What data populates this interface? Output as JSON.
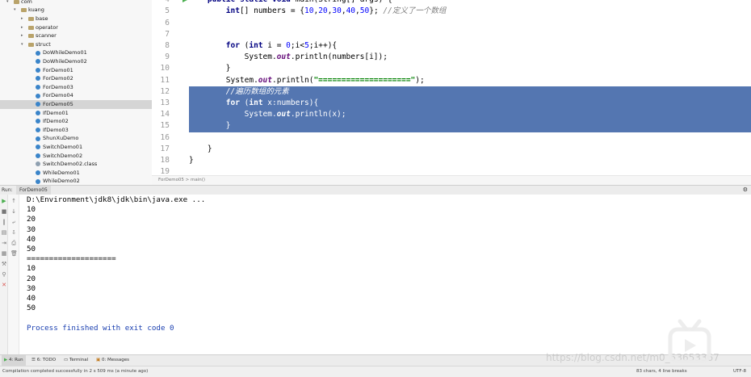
{
  "project_tree": {
    "items": [
      {
        "label": "com",
        "type": "folder",
        "indent": 1,
        "arrow": "v"
      },
      {
        "label": "kuang",
        "type": "folder",
        "indent": 2,
        "arrow": "v"
      },
      {
        "label": "base",
        "type": "folder",
        "indent": 3,
        "arrow": ">"
      },
      {
        "label": "operator",
        "type": "folder",
        "indent": 3,
        "arrow": ">"
      },
      {
        "label": "scanner",
        "type": "folder",
        "indent": 3,
        "arrow": ">"
      },
      {
        "label": "struct",
        "type": "folder",
        "indent": 3,
        "arrow": "v"
      },
      {
        "label": "DoWhileDemo01",
        "type": "class",
        "indent": 4
      },
      {
        "label": "DoWhileDemo02",
        "type": "class",
        "indent": 4
      },
      {
        "label": "ForDemo01",
        "type": "class",
        "indent": 4
      },
      {
        "label": "ForDemo02",
        "type": "class",
        "indent": 4
      },
      {
        "label": "ForDemo03",
        "type": "class",
        "indent": 4
      },
      {
        "label": "ForDemo04",
        "type": "class",
        "indent": 4
      },
      {
        "label": "ForDemo05",
        "type": "class",
        "indent": 4,
        "selected": true
      },
      {
        "label": "IfDemo01",
        "type": "class",
        "indent": 4
      },
      {
        "label": "IfDemo02",
        "type": "class",
        "indent": 4
      },
      {
        "label": "IfDemo03",
        "type": "class",
        "indent": 4
      },
      {
        "label": "ShunXuDemo",
        "type": "class",
        "indent": 4
      },
      {
        "label": "SwitchDemo01",
        "type": "class",
        "indent": 4
      },
      {
        "label": "SwitchDemo02",
        "type": "class",
        "indent": 4
      },
      {
        "label": "SwitchDemo02.class",
        "type": "file",
        "indent": 4
      },
      {
        "label": "WhileDemo01",
        "type": "class",
        "indent": 4
      },
      {
        "label": "WhileDemo02",
        "type": "class",
        "indent": 4
      }
    ]
  },
  "editor": {
    "lines": [
      {
        "n": "4",
        "text": "    public static void main(String[] args) {"
      },
      {
        "n": "5",
        "text": "        int[] numbers = {10,20,30,40,50}; //定义了一个数组"
      },
      {
        "n": "6",
        "text": ""
      },
      {
        "n": "7",
        "text": ""
      },
      {
        "n": "8",
        "text": "        for (int i = 0;i<5;i++){"
      },
      {
        "n": "9",
        "text": "            System.out.println(numbers[i]);"
      },
      {
        "n": "10",
        "text": "        }"
      },
      {
        "n": "11",
        "text": "        System.out.println(\"====================\");"
      },
      {
        "n": "12",
        "text": "        //遍历数组的元素"
      },
      {
        "n": "13",
        "text": "        for (int x:numbers){"
      },
      {
        "n": "14",
        "text": "            System.out.println(x);"
      },
      {
        "n": "15",
        "text": "        }"
      },
      {
        "n": "16",
        "text": ""
      },
      {
        "n": "17",
        "text": "    }"
      },
      {
        "n": "18",
        "text": "}"
      },
      {
        "n": "19",
        "text": ""
      }
    ],
    "breadcrumb": "ForDemo05  >  main()"
  },
  "run_panel": {
    "label": "Run:",
    "tab": "ForDemo05",
    "console": [
      "D:\\Environment\\jdk8\\jdk\\bin\\java.exe ...",
      "10",
      "20",
      "30",
      "40",
      "50",
      "====================",
      "10",
      "20",
      "30",
      "40",
      "50",
      "",
      "Process finished with exit code 0"
    ]
  },
  "toolwindows": {
    "run": "4: Run",
    "todo": "6: TODO",
    "terminal": "Terminal",
    "messages": "0: Messages"
  },
  "status": {
    "message": "Compilation completed successfully in 2 s 509 ms (a minute ago)",
    "position": "83 chars, 4 line breaks",
    "encoding": "UTF-8"
  },
  "watermark": "https://blog.csdn.net/m0_53653367"
}
